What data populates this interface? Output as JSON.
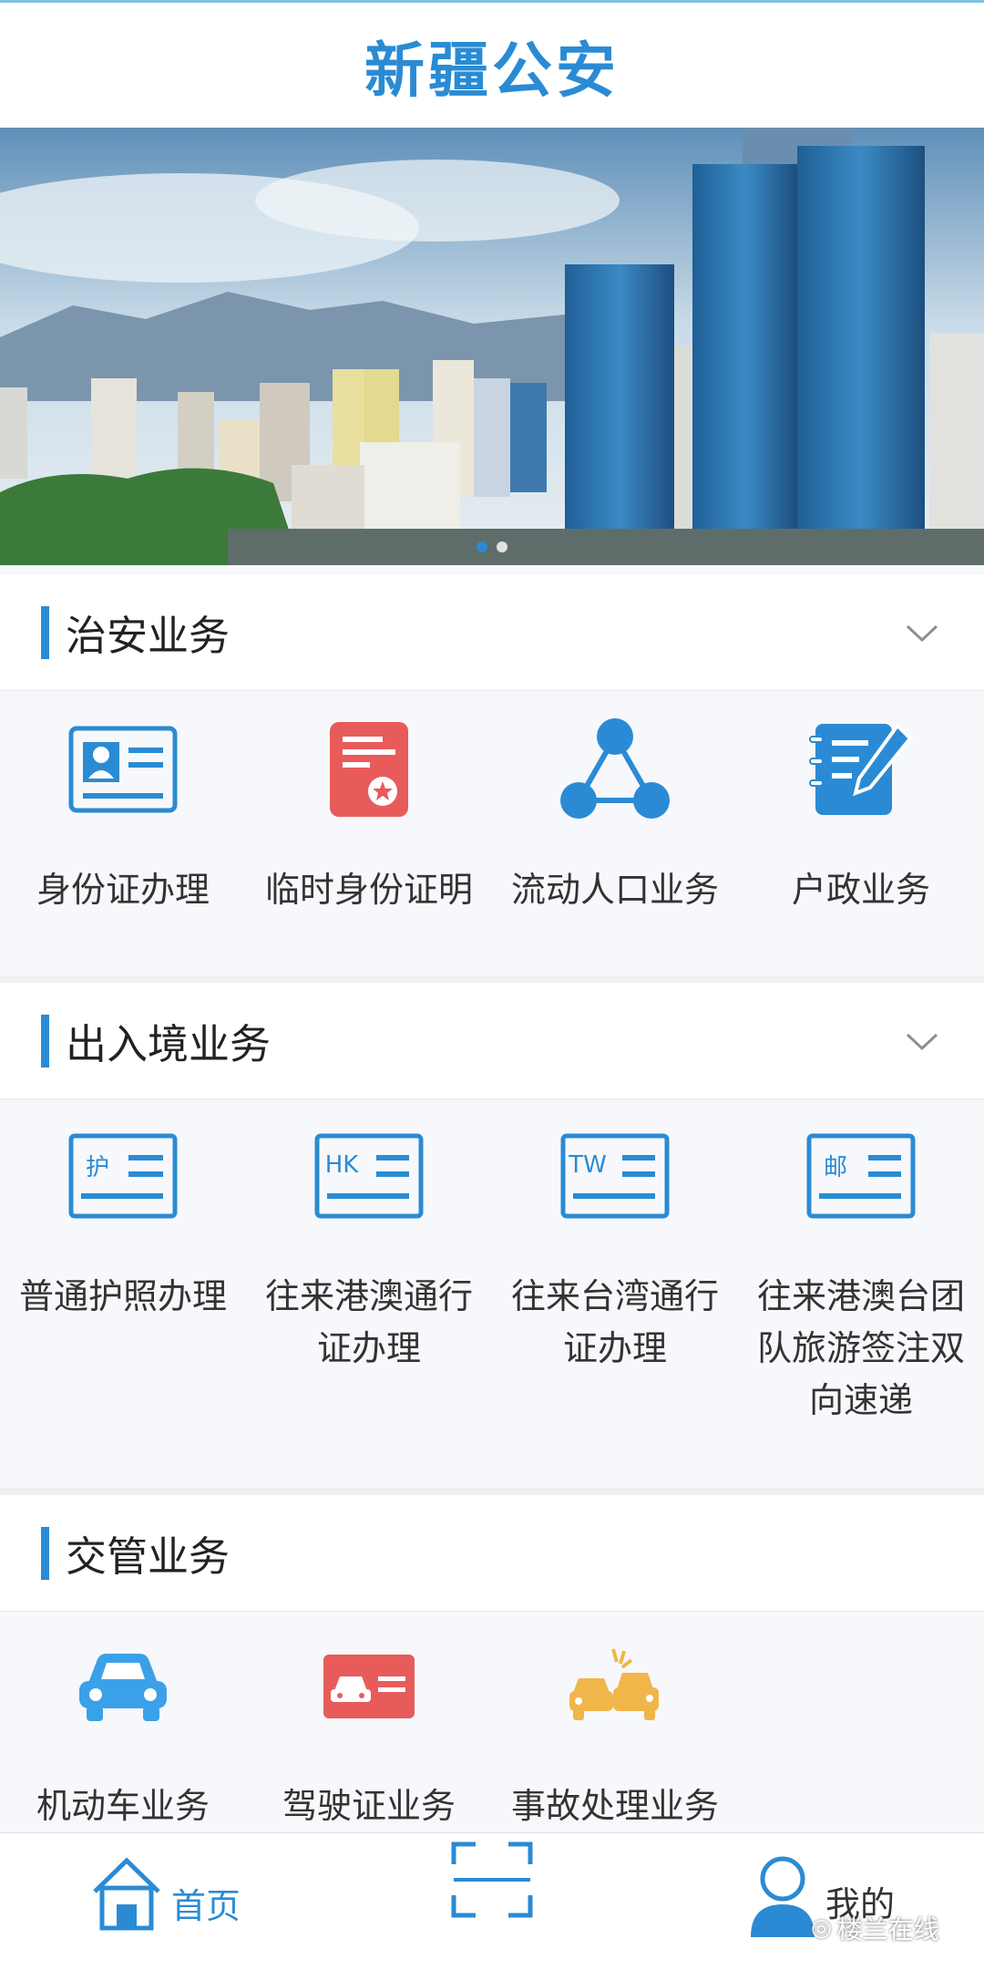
{
  "header": {
    "title": "新疆公安"
  },
  "banner": {
    "image": "city-skyline-photo",
    "dots": 2,
    "active_dot": 0
  },
  "sections": [
    {
      "title": "治安业务",
      "collapsible": true,
      "items": [
        {
          "label": "身份证办理",
          "icon": "id-card-icon"
        },
        {
          "label": "临时身份证明",
          "icon": "temporary-certificate-icon"
        },
        {
          "label": "流动人口业务",
          "icon": "floating-population-icon"
        },
        {
          "label": "户政业务",
          "icon": "household-register-icon"
        }
      ]
    },
    {
      "title": "出入境业务",
      "collapsible": true,
      "items": [
        {
          "label": "普通护照办理",
          "icon": "passport-icon",
          "badge": "护"
        },
        {
          "label": "往来港澳通行证办理",
          "icon": "hk-macao-permit-icon",
          "badge": "HK"
        },
        {
          "label": "往来台湾通行证办理",
          "icon": "taiwan-permit-icon",
          "badge": "TW"
        },
        {
          "label": "往来港澳台团队旅游签注双向速递",
          "icon": "express-mail-icon",
          "badge": "邮"
        }
      ]
    },
    {
      "title": "交管业务",
      "collapsible": false,
      "items": [
        {
          "label": "机动车业务",
          "icon": "car-icon"
        },
        {
          "label": "驾驶证业务",
          "icon": "driver-license-icon"
        },
        {
          "label": "事故处理业务",
          "icon": "accident-icon"
        }
      ]
    }
  ],
  "tabbar": {
    "home": "首页",
    "scan": "scan-icon",
    "me": "我的"
  },
  "watermark": "楼兰在线",
  "colors": {
    "accent": "#2a8bd4",
    "red": "#e85b5b",
    "car_blue": "#3aa1e8",
    "accident_yellow": "#f0b64a"
  }
}
